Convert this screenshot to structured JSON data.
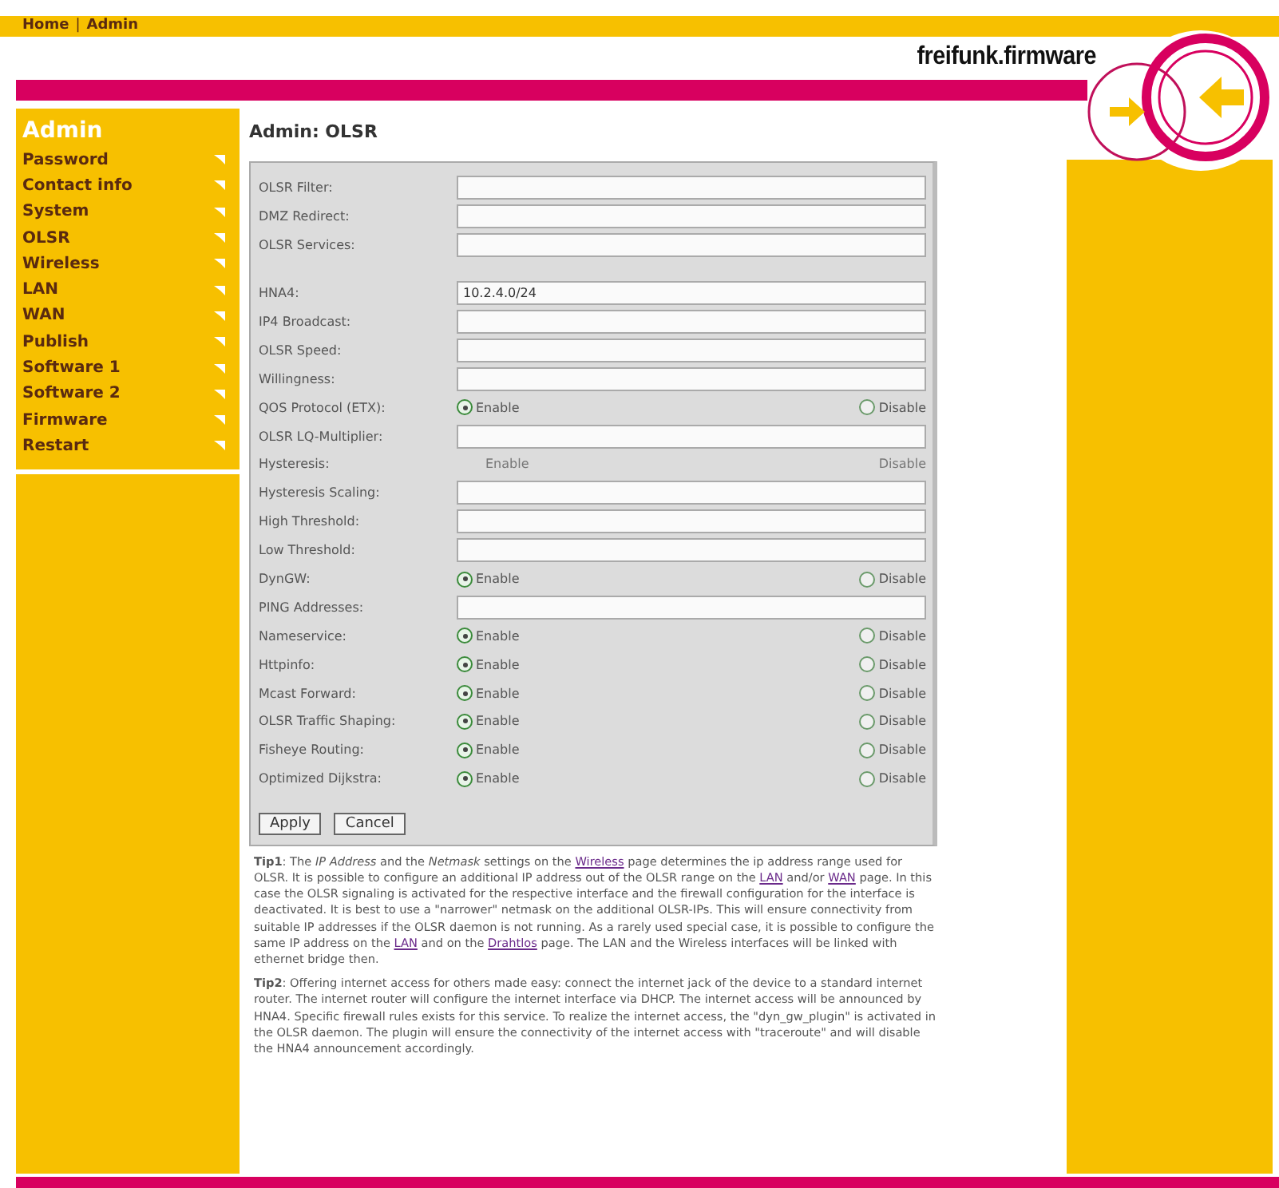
{
  "breadcrumb": [
    {
      "label": "Home"
    },
    {
      "label": "Admin"
    }
  ],
  "breadcrumb_separator": "|",
  "logo": {
    "text": "freifunk.firmware"
  },
  "sidebar": {
    "title": "Admin",
    "items": [
      {
        "label": "Password"
      },
      {
        "label": "Contact info"
      },
      {
        "label": "System"
      },
      {
        "label": "OLSR"
      },
      {
        "label": "Wireless"
      },
      {
        "label": "LAN"
      },
      {
        "label": "WAN"
      },
      {
        "label": "Publish"
      },
      {
        "label": "Software 1"
      },
      {
        "label": "Software 2"
      },
      {
        "label": "Firmware"
      },
      {
        "label": "Restart"
      }
    ]
  },
  "heading": "Admin: OLSR",
  "form": [
    {
      "kind": "text",
      "label": "OLSR Filter:"
    },
    {
      "kind": "text",
      "label": "DMZ Redirect:"
    },
    {
      "kind": "text",
      "label": "OLSR Services:"
    },
    {
      "kind": "spacer"
    },
    {
      "kind": "text",
      "label": "HNA4:",
      "value": "10.2.4.0/24"
    },
    {
      "kind": "text",
      "label": "IP4 Broadcast:"
    },
    {
      "kind": "text",
      "label": "OLSR Speed:"
    },
    {
      "kind": "text",
      "label": "Willingness:"
    },
    {
      "kind": "radio",
      "label": "QOS Protocol (ETX):",
      "options": [
        {
          "label": "Enable",
          "selected": true
        },
        {
          "label": "Disable",
          "selected": false
        }
      ]
    },
    {
      "kind": "text",
      "label": "OLSR LQ-Multiplier:"
    },
    {
      "kind": "radio",
      "label": "Hysteresis:",
      "disabled": true,
      "options": [
        {
          "label": "Enable"
        },
        {
          "label": "Disable"
        }
      ]
    },
    {
      "kind": "text",
      "label": "Hysteresis Scaling:"
    },
    {
      "kind": "text",
      "label": "High Threshold:"
    },
    {
      "kind": "text",
      "label": "Low Threshold:"
    },
    {
      "kind": "radio",
      "label": "DynGW:",
      "options": [
        {
          "label": "Enable",
          "selected": true
        },
        {
          "label": "Disable",
          "selected": false
        }
      ]
    },
    {
      "kind": "text",
      "label": "PING Addresses:"
    },
    {
      "kind": "radio",
      "label": "Nameservice:",
      "options": [
        {
          "label": "Enable",
          "selected": true
        },
        {
          "label": "Disable",
          "selected": false
        }
      ]
    },
    {
      "kind": "radio",
      "label": "Httpinfo:",
      "options": [
        {
          "label": "Enable",
          "selected": true
        },
        {
          "label": "Disable",
          "selected": false
        }
      ]
    },
    {
      "kind": "radio",
      "label": "Mcast Forward:",
      "options": [
        {
          "label": "Enable",
          "selected": true
        },
        {
          "label": "Disable",
          "selected": false
        }
      ]
    },
    {
      "kind": "radio",
      "label": "OLSR Traffic Shaping:",
      "options": [
        {
          "label": "Enable",
          "selected": true
        },
        {
          "label": "Disable",
          "selected": false
        }
      ]
    },
    {
      "kind": "radio",
      "label": "Fisheye Routing:",
      "options": [
        {
          "label": "Enable",
          "selected": true
        },
        {
          "label": "Disable",
          "selected": false
        }
      ]
    },
    {
      "kind": "radio",
      "label": "Optimized Dijkstra:",
      "options": [
        {
          "label": "Enable",
          "selected": true
        },
        {
          "label": "Disable",
          "selected": false
        }
      ]
    }
  ],
  "buttons": [
    {
      "label": "Apply"
    },
    {
      "label": "Cancel"
    }
  ],
  "tips": [
    {
      "parts": [
        {
          "text": "**Tip1**: The *IP Address* and the *Netmask* settings on the "
        },
        {
          "text": "Wireless",
          "link": true
        },
        {
          "text": " page determines the ip address range used for OLSR. It is possible to configure an additional IP address out of the OLSR range on the "
        },
        {
          "text": "LAN",
          "link": true
        },
        {
          "text": " and/or "
        },
        {
          "text": "WAN",
          "link": true
        },
        {
          "text": " page. In this case the OLSR signaling is activated for the respective interface and the firewall configuration for the interface is deactivated. It is best to use a \"narrower\" netmask on the additional OLSR-IPs. This will ensure connectivity from suitable IP addresses if the OLSR daemon is not running. As a rarely used special case, it is possible to configure the same IP address on the "
        },
        {
          "text": "LAN",
          "link": true
        },
        {
          "text": " and on the "
        },
        {
          "text": "Drahtlos",
          "link": true
        },
        {
          "text": " page. The LAN and the Wireless interfaces will be linked with ethernet bridge then."
        }
      ]
    },
    {
      "parts": [
        {
          "text": "**Tip2**: Offering internet access for others made easy: connect the internet jack of the device to a standard internet router. The internet router will configure the internet interface via DHCP. The internet access will be announced by HNA4. Specific firewall rules exists for this service. To realize the internet access, the \"dyn_gw_plugin\" is activated in the OLSR daemon. The plugin will ensure the connectivity of the internet access with \"traceroute\" and will disable the HNA4 announcement accordingly."
        }
      ]
    }
  ]
}
